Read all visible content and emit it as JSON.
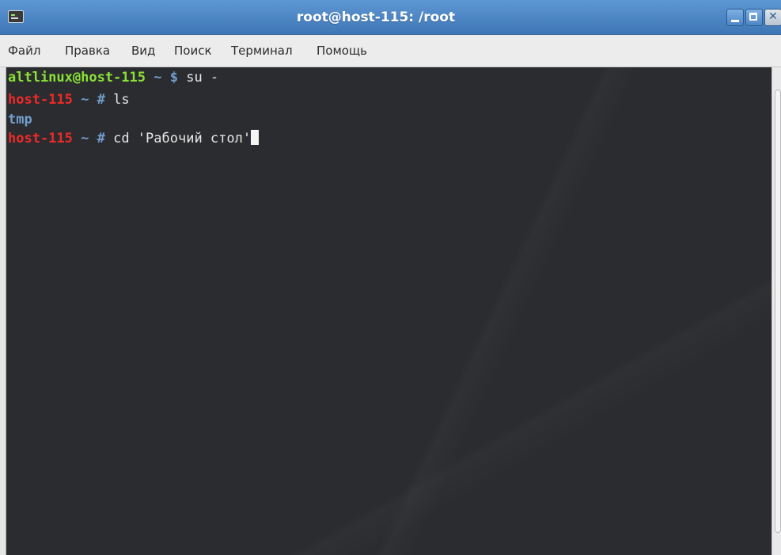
{
  "window": {
    "title": "root@host-115: /root"
  },
  "menu": {
    "items": [
      "Файл",
      "Правка",
      "Вид",
      "Поиск",
      "Терминал",
      "Помощь"
    ]
  },
  "terminal": {
    "lines": [
      {
        "user_host": "altlinux@host-115",
        "path": " ~ ",
        "symbol": "$",
        "command": " su -"
      },
      {
        "user_host": "host-115",
        "path": " ~ ",
        "symbol": "#",
        "command": " ls"
      },
      {
        "output": "tmp"
      },
      {
        "user_host": "host-115",
        "path": " ~ ",
        "symbol": "#",
        "command": " cd 'Рабочий стол'"
      }
    ]
  },
  "colors": {
    "prompt_user_green": "#8ae234",
    "prompt_root_red": "#ef2929",
    "prompt_symbol_blue": "#729fcf",
    "terminal_bg": "#2b2c2f",
    "titlebar": "#4a84c2"
  },
  "icons": {
    "title_app": "terminal-icon",
    "minimize": "minimize-icon",
    "maximize": "maximize-icon",
    "close": "close-icon"
  }
}
